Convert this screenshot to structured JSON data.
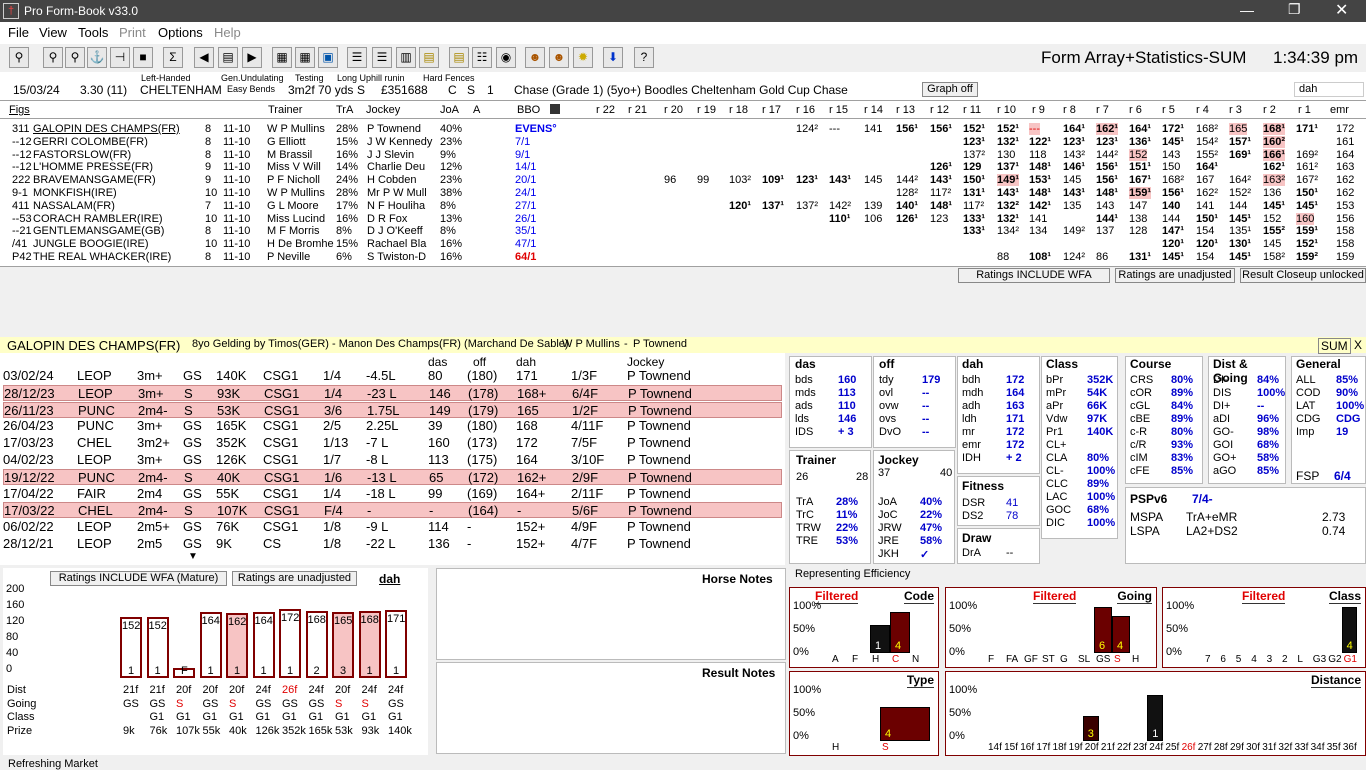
{
  "title": "Pro Form-Book v33.0",
  "menu": [
    "File",
    "View",
    "Tools",
    "Print",
    "Options",
    "Help"
  ],
  "toolbar_right": {
    "title": "Form Array+Statistics-SUM",
    "time": "1:34:39 pm"
  },
  "race": {
    "date": "15/03/24",
    "time": "3.30 (11)",
    "handed": "Left-Handed",
    "course": "CHELTENHAM",
    "going1": "Gen.Undulating",
    "going2": "Easy Bends",
    "testing": "Testing",
    "dist": "3m2f 70 yds",
    "s": "S",
    "uphill": "Long Uphill runin",
    "prize": "£351688",
    "hard": "Hard Fences",
    "c": "C",
    "s2": "S",
    "one": "1",
    "name": "Chase (Grade 1) (5yo+) Boodles Cheltenham Gold Cup Chase",
    "graph": "Graph off",
    "dah": "dah"
  },
  "cols": [
    "Figs",
    "Trainer",
    "TrA",
    "Jockey",
    "JoA",
    "A",
    "BBO",
    "r 22",
    "r 21",
    "r 20",
    "r 19",
    "r 18",
    "r 17",
    "r 16",
    "r 15",
    "r 14",
    "r 13",
    "r 12",
    "r 11",
    "r 10",
    "r 9",
    "r 8",
    "r 7",
    "r 6",
    "r 5",
    "r 4",
    "r 3",
    "r 2",
    "r 1",
    "emr"
  ],
  "runners": [
    [
      "311",
      "GALOPIN DES CHAMPS(FR)",
      "8",
      "11-10",
      "W P Mullins",
      "28%",
      "P Townend",
      "40%",
      "EVENS°"
    ],
    [
      "--12",
      "GERRI COLOMBE(FR)",
      "8",
      "11-10",
      "G Elliott",
      "15%",
      "J W Kennedy",
      "23%",
      "7/1"
    ],
    [
      "--12",
      "FASTORSLOW(FR)",
      "8",
      "11-10",
      "M Brassil",
      "16%",
      "J J Slevin",
      "9%",
      "9/1"
    ],
    [
      "--12",
      "L'HOMME PRESSE(FR)",
      "9",
      "11-10",
      "Miss V Will",
      "14%",
      "Charlie Deu",
      "12%",
      "14/1"
    ],
    [
      "222",
      "BRAVEMANSGAME(FR)",
      "9",
      "11-10",
      "P F Nicholl",
      "24%",
      "H Cobden",
      "23%",
      "20/1"
    ],
    [
      "9-1",
      "MONKFISH(IRE)",
      "10",
      "11-10",
      "W P Mullins",
      "28%",
      "Mr P W Mull",
      "38%",
      "24/1"
    ],
    [
      "411",
      "NASSALAM(FR)",
      "7",
      "11-10",
      "G L Moore",
      "17%",
      "N F Houliha",
      "8%",
      "27/1"
    ],
    [
      "--53",
      "CORACH RAMBLER(IRE)",
      "10",
      "11-10",
      "Miss Lucind",
      "16%",
      "D R Fox",
      "13%",
      "26/1"
    ],
    [
      "--21",
      "GENTLEMANSGAME(GB)",
      "8",
      "11-10",
      "M F Morris",
      "8%",
      "D J O'Keeff",
      "8%",
      "35/1"
    ],
    [
      "/41",
      "JUNGLE BOOGIE(IRE)",
      "10",
      "11-10",
      "H De Bromhe",
      "15%",
      "Rachael Bla",
      "16%",
      "47/1"
    ],
    [
      "P42",
      "THE REAL WHACKER(IRE)",
      "8",
      "11-10",
      "P Neville",
      "6%",
      "S Twiston-D",
      "16%",
      "64/1"
    ]
  ],
  "ratings": [
    {
      "r16": "124²",
      "r15": "---",
      "r14": "141",
      "r13": "156¹",
      "r12": "156¹",
      "r11": "152¹",
      "r10": "152¹",
      "r9": "---",
      "r8": "164¹",
      "r7": "162¹",
      "r6": "164¹",
      "r5": "172¹",
      "r4": "168²",
      "r3": "165",
      "r2": "168¹",
      "r1": "171¹",
      "emr": "172"
    },
    {
      "r11": "123¹",
      "r10": "132¹",
      "r9": "122¹",
      "r8": "123¹",
      "r7": "123¹",
      "r6": "136¹",
      "r5": "145¹",
      "r4": "154²",
      "r3": "157¹",
      "r2": "160²",
      "emr": "161"
    },
    {
      "r11": "137²",
      "r10": "130",
      "r9": "118",
      "r8": "143²",
      "r7": "144²",
      "r6": "152",
      "r5": "143",
      "r4": "155²",
      "r3": "169¹",
      "r2": "166¹",
      "r1": "169²",
      "emr": "164"
    },
    {
      "r12": "126¹",
      "r11": "129",
      "r10": "137¹",
      "r9": "148¹",
      "r8": "146¹",
      "r7": "156¹",
      "r6": "151¹",
      "r5": "150",
      "r4": "164¹",
      "r2": "162¹",
      "r1": "161²",
      "emr": "163"
    },
    {
      "r20": "96",
      "r19": "99",
      "r18": "103²",
      "r17": "109¹",
      "r16": "123¹",
      "r15": "143¹",
      "r14": "145",
      "r13": "144²",
      "r12": "143¹",
      "r11": "150¹",
      "r10": "149¹",
      "r9": "153¹",
      "r8": "145",
      "r7": "156¹",
      "r6": "167¹",
      "r5": "168²",
      "r4": "167",
      "r3": "164²",
      "r2": "163²",
      "r1": "167²",
      "emr": "162"
    },
    {
      "r13": "128²",
      "r12": "117²",
      "r11": "131¹",
      "r10": "143¹",
      "r9": "148¹",
      "r8": "143¹",
      "r7": "148¹",
      "r6": "159¹",
      "r5": "156¹",
      "r4": "162²",
      "r3": "152²",
      "r2": "136",
      "r1": "150¹",
      "emr": "162"
    },
    {
      "r18": "120¹",
      "r17": "137¹",
      "r16": "137²",
      "r15": "142²",
      "r14": "139",
      "r13": "140¹",
      "r12": "148¹",
      "r11": "117²",
      "r10": "132²",
      "r9": "142¹",
      "r8": "135",
      "r7": "143",
      "r6": "147",
      "r5": "140",
      "r4": "141",
      "r3": "144",
      "r2": "145¹",
      "r1": "145¹",
      "emr": "153"
    },
    {
      "r15": "110¹",
      "r14": "106",
      "r13": "126¹",
      "r12": "123",
      "r11": "133¹",
      "r10": "132¹",
      "r9": "141",
      "r7": "144¹",
      "r6": "138",
      "r5": "144",
      "r4": "150¹",
      "r3": "145¹",
      "r2": "152",
      "r1": "160",
      "emr": "156"
    },
    {
      "r11": "133¹",
      "r10": "134²",
      "r9": "134",
      "r8": "149²",
      "r7": "137",
      "r6": "128",
      "r5": "147¹",
      "r4": "154",
      "r3": "135¹",
      "r2": "155²",
      "r1": "159¹",
      "emr": "158"
    },
    {
      "r5": "120¹",
      "r4": "120¹",
      "r3": "130¹",
      "r2": "145",
      "r1": "152¹",
      "emr": "158"
    },
    {
      "r10": "88",
      "r9": "108¹",
      "r8": "124²",
      "r7": "86",
      "r6": "131¹",
      "r5": "145¹",
      "r4": "154",
      "r3": "145¹",
      "r2": "158²",
      "r1": "159²",
      "emr": "159"
    }
  ],
  "bottom_btns": [
    "Ratings INCLUDE WFA",
    "Ratings are unadjusted",
    "Result Closeup unlocked"
  ],
  "horse": {
    "name": "GALOPIN DES CHAMPS(FR)",
    "desc": "8yo Gelding by Timos(GER) - Manon Des Champs(FR) (Marchand De Sable)",
    "trainer": "W P Mullins",
    "jockey": "P Townend",
    "sum": "SUM",
    "x": "X"
  },
  "form_headers": {
    "das": "das",
    "off": "off",
    "dah": "dah",
    "jockey": "Jockey"
  },
  "form": [
    [
      "03/02/24",
      "LEOP",
      "3m+",
      "GS",
      "140K",
      "CSG1",
      "1/4",
      "-4.5L",
      "80",
      "(180)",
      "171",
      "1/3F",
      "P Townend",
      false
    ],
    [
      "28/12/23",
      "LEOP",
      "3m+",
      "S",
      "93K",
      "CSG1",
      "1/4",
      "-23 L",
      "146",
      "(178)",
      "168+",
      "6/4F",
      "P Townend",
      true
    ],
    [
      "26/11/23",
      "PUNC",
      "2m4-",
      "S",
      "53K",
      "CSG1",
      "3/6",
      "1.75L",
      "149",
      "(179)",
      "165",
      "1/2F",
      "P Townend",
      true
    ],
    [
      "26/04/23",
      "PUNC",
      "3m+",
      "GS",
      "165K",
      "CSG1",
      "2/5",
      "2.25L",
      "39",
      "(180)",
      "168",
      "4/11F",
      "P Townend",
      false
    ],
    [
      "17/03/23",
      "CHEL",
      "3m2+",
      "GS",
      "352K",
      "CSG1",
      "1/13",
      "-7 L",
      "160",
      "(173)",
      "172",
      "7/5F",
      "P Townend",
      false
    ],
    [
      "04/02/23",
      "LEOP",
      "3m+",
      "GS",
      "126K",
      "CSG1",
      "1/7",
      "-8 L",
      "113",
      "(175)",
      "164",
      "3/10F",
      "P Townend",
      false
    ],
    [
      "19/12/22",
      "PUNC",
      "2m4-",
      "S",
      "40K",
      "CSG1",
      "1/6",
      "-13 L",
      "65",
      "(172)",
      "162+",
      "2/9F",
      "P Townend",
      true
    ],
    [
      "17/04/22",
      "FAIR",
      "2m4",
      "GS",
      "55K",
      "CSG1",
      "1/4",
      "-18 L",
      "99",
      "(169)",
      "164+",
      "2/11F",
      "P Townend",
      false
    ],
    [
      "17/03/22",
      "CHEL",
      "2m4-",
      "S",
      "107K",
      "CSG1",
      "F/4",
      "-",
      "-",
      "(164)",
      "-",
      "5/6F",
      "P Townend",
      true
    ],
    [
      "06/02/22",
      "LEOP",
      "2m5+",
      "GS",
      "76K",
      "CSG1",
      "1/8",
      "-9 L",
      "114",
      "-",
      "152+",
      "4/9F",
      "P Townend",
      false
    ],
    [
      "28/12/21",
      "LEOP",
      "2m5",
      "GS",
      "9K",
      "CS",
      "1/8",
      "-22 L",
      "136",
      "-",
      "152+",
      "4/7F",
      "P Townend",
      false
    ]
  ],
  "mini": {
    "btn1": "Ratings INCLUDE WFA (Mature)",
    "btn2": "Ratings are unadjusted",
    "dah": "dah",
    "yticks": [
      "200",
      "160",
      "120",
      "80",
      "40",
      "0"
    ],
    "bars": [
      {
        "v": 152,
        "pos": "1",
        "h": false
      },
      {
        "v": 152,
        "pos": "1",
        "h": false
      },
      {
        "v": 0,
        "pos": "F",
        "h": false
      },
      {
        "v": 164,
        "pos": "1",
        "h": false
      },
      {
        "v": 162,
        "pos": "1",
        "h": true
      },
      {
        "v": 164,
        "pos": "1",
        "h": false
      },
      {
        "v": 172,
        "pos": "1",
        "h": false
      },
      {
        "v": 168,
        "pos": "2",
        "h": false
      },
      {
        "v": 165,
        "pos": "3",
        "h": true
      },
      {
        "v": 168,
        "pos": "1",
        "h": true
      },
      {
        "v": 171,
        "pos": "1",
        "h": false
      }
    ],
    "rowlabels": [
      "Dist",
      "Going",
      "Class",
      "Prize"
    ],
    "dist": [
      "21f",
      "21f",
      "20f",
      "20f",
      "20f",
      "24f",
      "26f",
      "24f",
      "20f",
      "24f",
      "24f"
    ],
    "going": [
      "GS",
      "GS",
      "S",
      "GS",
      "S",
      "GS",
      "GS",
      "GS",
      "S",
      "S",
      "GS"
    ],
    "class": [
      "",
      "G1",
      "G1",
      "G1",
      "G1",
      "G1",
      "G1",
      "G1",
      "G1",
      "G1",
      "G1"
    ],
    "prize": [
      "9k",
      "76k",
      "107k",
      "55k",
      "40k",
      "126k",
      "352k",
      "165k",
      "53k",
      "93k",
      "140k"
    ]
  },
  "notes": {
    "horse": "Horse Notes",
    "result": "Result Notes"
  },
  "stats": {
    "das": {
      "h": "das",
      "rows": [
        [
          "bds",
          "160"
        ],
        [
          "mds",
          "113"
        ],
        [
          "ads",
          "110"
        ],
        [
          "lds",
          "146"
        ],
        [
          "IDS",
          "+ 3"
        ]
      ]
    },
    "off": {
      "h": "off",
      "rows": [
        [
          "tdy",
          "179"
        ],
        [
          "ovl",
          "--"
        ],
        [
          "ovw",
          "--"
        ],
        [
          "ovs",
          "--"
        ],
        [
          "DvO",
          "--"
        ]
      ]
    },
    "dah": {
      "h": "dah",
      "rows": [
        [
          "bdh",
          "172"
        ],
        [
          "mdh",
          "164"
        ],
        [
          "adh",
          "163"
        ],
        [
          "ldh",
          "171"
        ],
        [
          "mr",
          "172"
        ],
        [
          "emr",
          "172"
        ],
        [
          "IDH",
          "+ 2"
        ]
      ]
    },
    "cls": {
      "h": "Class",
      "rows": [
        [
          "bPr",
          "352K"
        ],
        [
          "mPr",
          "54K"
        ],
        [
          "aPr",
          "66K"
        ],
        [
          "Vdw",
          "97K"
        ],
        [
          "Pr1",
          "140K"
        ],
        [
          "CL+",
          ""
        ],
        [
          "CLA",
          "80%"
        ],
        [
          "CL-",
          "100%"
        ],
        [
          "CLC",
          "89%"
        ],
        [
          "LAC",
          "100%"
        ],
        [
          "GOC",
          "68%"
        ],
        [
          "DIC",
          "100%"
        ]
      ]
    },
    "course": {
      "h": "Course",
      "rows": [
        [
          "CRS",
          "80%"
        ],
        [
          "cOR",
          "89%"
        ],
        [
          "cGL",
          "84%"
        ],
        [
          "cBE",
          "89%"
        ],
        [
          "c-R",
          "80%"
        ],
        [
          "c/R",
          "93%"
        ],
        [
          "cIM",
          "83%"
        ],
        [
          "cFE",
          "85%"
        ]
      ]
    },
    "dg": {
      "h": "Dist & Going",
      "rows": [
        [
          "DI-",
          "84%"
        ],
        [
          "DIS",
          "100%"
        ],
        [
          "DI+",
          "--"
        ],
        [
          "aDI",
          "96%"
        ],
        [
          "GO-",
          "98%"
        ],
        [
          "GOI",
          "68%"
        ],
        [
          "GO+",
          "58%"
        ],
        [
          "aGO",
          "85%"
        ]
      ]
    },
    "gen": {
      "h": "General",
      "rows": [
        [
          "ALL",
          "85%"
        ],
        [
          "COD",
          "90%"
        ],
        [
          "LAT",
          "100%"
        ],
        [
          "CDG",
          "CDG"
        ],
        [
          "Imp",
          "19"
        ]
      ],
      "fsp": "FSP",
      "fspv": "6/4"
    },
    "trainer": {
      "h": "Trainer",
      "a": "26",
      "b": "28",
      "rows": [
        [
          "TrA",
          "28%"
        ],
        [
          "TrC",
          "11%"
        ],
        [
          "TRW",
          "22%"
        ],
        [
          "TRE",
          "53%"
        ]
      ]
    },
    "jockey": {
      "h": "Jockey",
      "a": "37",
      "b": "40",
      "rows": [
        [
          "JoA",
          "40%"
        ],
        [
          "JoC",
          "22%"
        ],
        [
          "JRW",
          "47%"
        ],
        [
          "JRE",
          "58%"
        ],
        [
          "JKH",
          "✓"
        ]
      ]
    },
    "fitness": {
      "h": "Fitness",
      "rows": [
        [
          "DSR",
          "41"
        ],
        [
          "DS2",
          "78"
        ]
      ]
    },
    "draw": {
      "h": "Draw",
      "rows": [
        [
          "DrA",
          "--"
        ]
      ]
    },
    "pspv": {
      "h": "PSPv6",
      "v": "7/4-",
      "rows": [
        [
          "MSPA",
          "TrA+eMR",
          "2.73"
        ],
        [
          "LSPA",
          "LA2+DS2",
          "0.74"
        ]
      ]
    }
  },
  "eff": {
    "title": "Representing Efficiency",
    "filtered": "Filtered",
    "yt": [
      "100%",
      "50%",
      "0%"
    ],
    "code": {
      "h": "Code",
      "x": [
        "A",
        "F",
        "H",
        "C",
        "N"
      ]
    },
    "going": {
      "h": "Going",
      "x": [
        "F",
        "FA",
        "GF",
        "ST",
        "G",
        "SL",
        "GS",
        "S",
        "H"
      ]
    },
    "class": {
      "h": "Class",
      "x": [
        "7",
        "6",
        "5",
        "4",
        "3",
        "2",
        "L",
        "G3",
        "G2",
        "G1"
      ]
    },
    "type": {
      "h": "Type",
      "x": [
        "H",
        "S"
      ]
    },
    "distance": {
      "h": "Distance",
      "x": [
        "14f",
        "15f",
        "16f",
        "17f",
        "18f",
        "19f",
        "20f",
        "21f",
        "22f",
        "23f",
        "24f",
        "25f",
        "26f",
        "27f",
        "28f",
        "29f",
        "30f",
        "31f",
        "32f",
        "33f",
        "34f",
        "35f",
        "36f"
      ]
    }
  },
  "status": "Refreshing Market",
  "colors": {
    "pink": "#f7c4c4",
    "darkred": "#6b0000",
    "accent": "#0000ee"
  }
}
